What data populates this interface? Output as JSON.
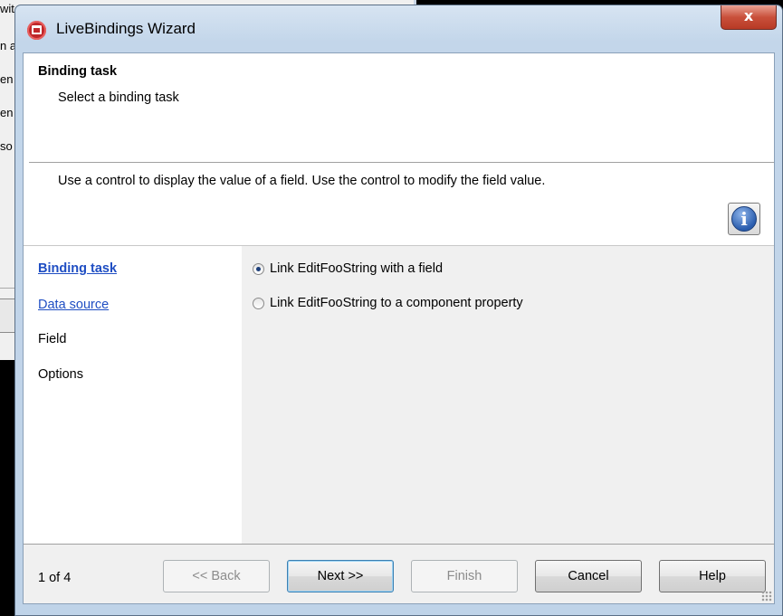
{
  "background_window": {
    "lines": [
      "wit",
      "n a",
      "en",
      "en",
      "so"
    ]
  },
  "window": {
    "title": "LiveBindings Wizard",
    "close_label": "x"
  },
  "header": {
    "title": "Binding task",
    "subtitle": "Select a binding task",
    "description": "Use a control to display the value of a field.  Use the control to modify the field value."
  },
  "info_button": {
    "glyph": "i"
  },
  "steps": [
    {
      "label": "Binding task",
      "state": "current"
    },
    {
      "label": "Data source",
      "state": "link"
    },
    {
      "label": "Field",
      "state": "plain"
    },
    {
      "label": "Options",
      "state": "plain"
    }
  ],
  "options": [
    {
      "label": "Link EditFooString with a field",
      "checked": true
    },
    {
      "label": "Link EditFooString to a component property",
      "checked": false
    }
  ],
  "footer": {
    "page_count": "1 of 4",
    "back_label": "<< Back",
    "next_label": "Next >>",
    "finish_label": "Finish",
    "cancel_label": "Cancel",
    "help_label": "Help"
  },
  "colors": {
    "link": "#1f4ec3",
    "title_gradient_top": "#d7e4f2",
    "close_button": "#c9503b",
    "content_bg": "#f0f0f0"
  }
}
